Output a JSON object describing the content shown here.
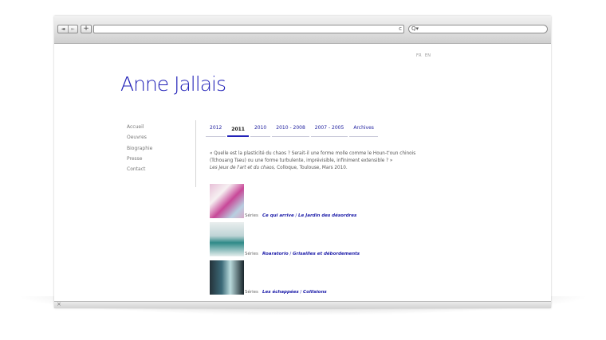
{
  "site": {
    "title": "Anne Jallais",
    "lang": [
      "FR",
      "EN"
    ]
  },
  "browser": {
    "nav_back": "◄",
    "nav_forward": "►",
    "add_label": "+",
    "reload_icon": "c",
    "search_icon": "Q▾",
    "close_icon": "×"
  },
  "nav": {
    "items": [
      "Accueil",
      "Oeuvres",
      "Biographie",
      "Presse",
      "Contact"
    ]
  },
  "tabs": {
    "items": [
      "2012",
      "2011",
      "2010",
      "2010 - 2008",
      "2007 - 2005",
      "Archives"
    ],
    "active": "2011"
  },
  "quote": {
    "line1": "« Quelle est la plasticité du chaos ? Serait-il une forme molle comme le Houn-t'oun chinois",
    "line2": "(Tchouang Tseu) ou une forme turbulente, imprévisible, infiniment extensible ? »",
    "source_italic": "Les Jeux de l'art et du chaos,",
    "source_rest": " Colloque, Toulouse, Mars 2010."
  },
  "series": [
    {
      "label": "Séries",
      "link1": "Ce qui arrive",
      "sep": " / ",
      "link2": "Le Jardin des désordres"
    },
    {
      "label": "Séries",
      "link1": "Roaratorio",
      "sep": " / ",
      "link2": "Grisailles et débordements"
    },
    {
      "label": "Séries",
      "link1": "Les échappées",
      "sep": " / ",
      "link2": "Collisions"
    }
  ],
  "colors": {
    "accent": "#2222b8",
    "link": "#1a1aa8"
  }
}
